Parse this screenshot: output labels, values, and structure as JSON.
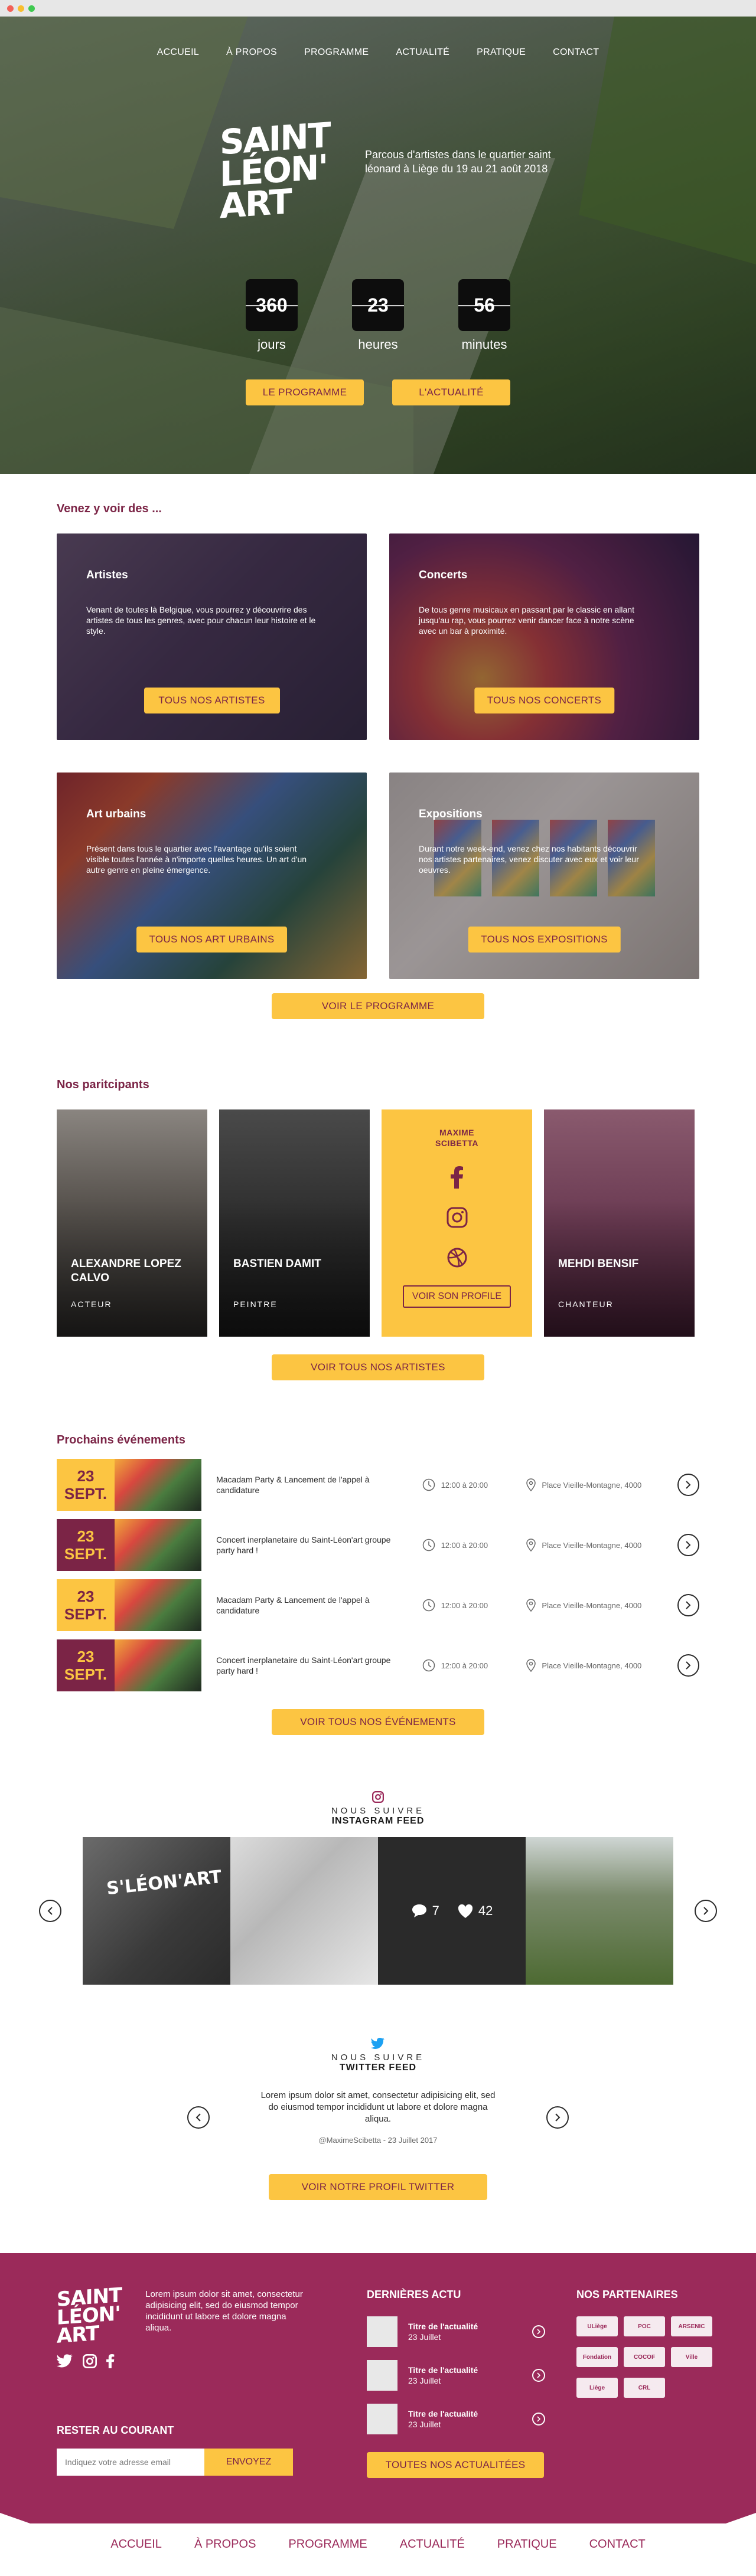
{
  "nav": [
    "ACCUEIL",
    "À PROPOS",
    "PROGRAMME",
    "ACTUALITÉ",
    "PRATIQUE",
    "CONTACT"
  ],
  "hero": {
    "logo_lines": [
      "SAINT",
      "LÉON'",
      "ART"
    ],
    "tagline": "Parcous d'artistes dans le quartier saint léonard à Liège du 19 au 21 août 2018",
    "countdown": [
      {
        "value": "360",
        "label": "jours"
      },
      {
        "value": "23",
        "label": "heures"
      },
      {
        "value": "56",
        "label": "minutes"
      }
    ],
    "btn_programme": "LE PROGRAMME",
    "btn_actualite": "L'ACTUALITÉ"
  },
  "venez": {
    "title": "Venez y voir des ...",
    "cards": [
      {
        "title": "Artistes",
        "desc": "Venant de toutes là Belgique, vous pourrez y découvrire des artistes de tous les genres, avec pour chacun leur histoire et le style.",
        "button": "TOUS NOS ARTISTES"
      },
      {
        "title": "Concerts",
        "desc": "De tous genre musicaux en passant par le classic en allant jusqu'au rap, vous pourrez venir dancer face à notre scène avec un bar à proximité.",
        "button": "TOUS NOS CONCERTS"
      },
      {
        "title": "Art urbains",
        "desc": "Présent dans tous le quartier avec l'avantage qu'ils soient visible toutes l'année à n'importe quelles heures. Un art d'un autre genre en pleine émergence.",
        "button": "TOUS NOS ART URBAINS"
      },
      {
        "title": "Expositions",
        "desc": "Durant notre week-end, venez chez nos habitants découvrir nos artistes partenaires, venez discuter avec eux et voir leur oeuvres.",
        "button": "TOUS NOS EXPOSITIONS"
      }
    ],
    "btn_programme": "VOIR LE PROGRAMME"
  },
  "participants": {
    "title": "Nos paritcipants",
    "cards": [
      {
        "name": "ALEXANDRE LOPEZ CALVO",
        "role": "ACTEUR"
      },
      {
        "name": "BASTIEN DAMIT",
        "role": "PEINTRE"
      },
      {
        "name": "MAXIME SCIBETTA",
        "profile_btn": "VOIR SON PROFILE"
      },
      {
        "name": "MEHDI BENSIF",
        "role": "CHANTEUR"
      }
    ],
    "btn_all": "VOIR TOUS NOS ARTISTES"
  },
  "events": {
    "title": "Prochains événements",
    "items": [
      {
        "day": "23",
        "month": "SEPT.",
        "title": "Macadam Party & Lancement de l'appel à candidature",
        "time": "12:00 à 20:00",
        "place": "Place Vieille-Montagne, 4000"
      },
      {
        "day": "23",
        "month": "SEPT.",
        "title": "Concert inerplanetaire du Saint-Léon'art groupe party hard !",
        "time": "12:00 à 20:00",
        "place": "Place Vieille-Montagne, 4000"
      },
      {
        "day": "23",
        "month": "SEPT.",
        "title": "Macadam Party & Lancement de l'appel à candidature",
        "time": "12:00 à 20:00",
        "place": "Place Vieille-Montagne, 4000"
      },
      {
        "day": "23",
        "month": "SEPT.",
        "title": "Concert inerplanetaire du Saint-Léon'art groupe party hard !",
        "time": "12:00 à 20:00",
        "place": "Place Vieille-Montagne, 4000"
      }
    ],
    "btn_all": "VOIR TOUS NOS ÉVÉNEMENTS"
  },
  "instagram": {
    "follow": "NOUS SUIVRE",
    "title": "INSTAGRAM FEED",
    "image1_text": "S'LÉON'ART",
    "comments": "7",
    "likes": "42"
  },
  "twitter": {
    "follow": "NOUS SUIVRE",
    "title": "TWITTER FEED",
    "tweet": "Lorem ipsum dolor sit amet, consectetur adipisicing elit, sed do eiusmod tempor incididunt ut labore et dolore magna aliqua.",
    "meta": "@MaximeScibetta - 23 Juillet 2017",
    "btn": "VOIR NOTRE PROFIL TWITTER"
  },
  "footer": {
    "logo_lines": [
      "SAINT",
      "LÉON'",
      "ART"
    ],
    "lorem": "Lorem ipsum dolor sit amet, consectetur adipisicing elit, sed do eiusmod tempor incididunt ut labore et dolore magna aliqua.",
    "news_title": "DERNIÈRES ACTU",
    "news": [
      {
        "title": "Titre de l'actualité",
        "date": "23 Juillet"
      },
      {
        "title": "Titre de l'actualité",
        "date": "23 Juillet"
      },
      {
        "title": "Titre de l'actualité",
        "date": "23 Juillet"
      }
    ],
    "news_btn": "TOUTES NOS ACTUALITÉES",
    "partners_title": "NOS PARTENAIRES",
    "partners": [
      "ULiège",
      "POC",
      "ARSENIC",
      "Fondation",
      "COCOF",
      "Ville",
      "Liège",
      "CRL"
    ],
    "newsletter_title": "RESTER AU COURANT",
    "newsletter_placeholder": "Indiquez votre adresse email",
    "newsletter_btn": "ENVOYEZ"
  },
  "colors": {
    "accent_yellow": "#fcc542",
    "brand_purple": "#7b2446",
    "footer_purple": "#9b2a5a"
  }
}
